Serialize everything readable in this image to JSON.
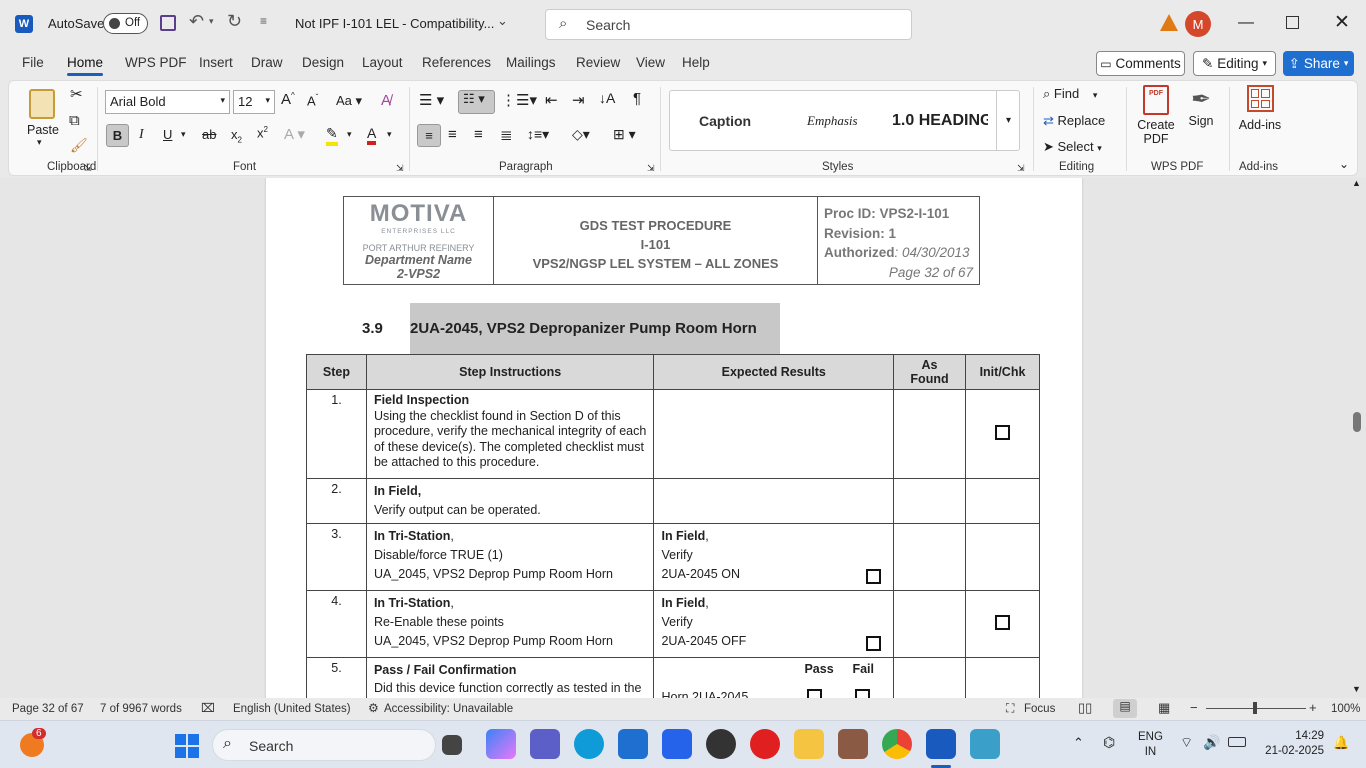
{
  "titlebar": {
    "autosave_label": "AutoSave",
    "autosave_state": "Off",
    "doc_title": "Not IPF I-101 LEL  -  Compatibility...",
    "search_placeholder": "Search",
    "user_initial": "M"
  },
  "tabs": [
    "File",
    "Home",
    "WPS PDF",
    "Insert",
    "Draw",
    "Design",
    "Layout",
    "References",
    "Mailings",
    "Review",
    "View",
    "Help"
  ],
  "tabs_right": {
    "comments": "Comments",
    "editing": "Editing",
    "share": "Share"
  },
  "ribbon": {
    "clipboard": {
      "paste": "Paste",
      "group": "Clipboard"
    },
    "font": {
      "name": "Arial Bold",
      "size": "12",
      "group": "Font",
      "bold": "B",
      "italic": "I",
      "underline": "U"
    },
    "paragraph": {
      "group": "Paragraph"
    },
    "styles": {
      "group": "Styles",
      "items": [
        "Caption",
        "Emphasis",
        "1.0  HEADING"
      ]
    },
    "editing": {
      "group": "Editing",
      "find": "Find",
      "replace": "Replace",
      "select": "Select"
    },
    "wpspdf": {
      "group": "WPS PDF",
      "create_pdf_line1": "Create",
      "create_pdf_line2": "PDF",
      "sign": "Sign"
    },
    "addins": {
      "group": "Add-ins",
      "label": "Add-ins"
    }
  },
  "doc": {
    "logo": {
      "name": "MOTIVA",
      "sub": "ENTERPRISES LLC",
      "refinery": "PORT ARTHUR REFINERY",
      "dept1": "Department Name",
      "dept2": "2-VPS2"
    },
    "header_center": {
      "l1": "GDS TEST PROCEDURE",
      "l2": "I-101",
      "l3": "VPS2/NGSP LEL SYSTEM – ALL ZONES"
    },
    "header_right": {
      "proc": "Proc ID: VPS2-I-101",
      "rev": "Revision: 1",
      "auth_label": "Authorized",
      "auth_date": ": 04/30/2013",
      "page": "Page 32 of 67"
    },
    "section_num": "3.9",
    "section_title": "2UA-2045, VPS2 Depropanizer Pump Room Horn",
    "table_headers": [
      "Step",
      "Step Instructions",
      "Expected Results",
      "As Found",
      "Init/Chk"
    ],
    "rows": [
      {
        "step": "1.",
        "title": "Field Inspection",
        "text": "Using the checklist found in Section D of this procedure, verify the mechanical integrity of each of these device(s). The completed checklist must be attached to this procedure."
      },
      {
        "step": "2.",
        "title": "In Field,",
        "text": "Verify output can be operated."
      },
      {
        "step": "3.",
        "title": "In Tri-Station",
        "title_suffix": ",",
        "l2": "Disable/force TRUE (1)",
        "l3": "UA_2045, VPS2 Deprop Pump Room Horn",
        "exp_title": "In Field",
        "exp_suffix": ",",
        "exp_l2": "Verify",
        "exp_l3": "2UA-2045 ON"
      },
      {
        "step": "4.",
        "title": "In Tri-Station",
        "title_suffix": ",",
        "l2": "Re-Enable these points",
        "l3": "UA_2045, VPS2 Deprop Pump Room Horn",
        "exp_title": "In Field",
        "exp_suffix": ",",
        "exp_l2": "Verify",
        "exp_l3": "2UA-2045 OFF"
      },
      {
        "step": "5.",
        "title": "Pass / Fail Confirmation",
        "text": "Did this device function correctly as tested in the previous steps?",
        "pass": "Pass",
        "fail": "Fail",
        "exp_l1": "Horn 2UA-2045"
      }
    ]
  },
  "status": {
    "page": "Page 32 of 67",
    "words": "7 of 9967 words",
    "lang": "English (United States)",
    "access": "Accessibility: Unavailable",
    "focus": "Focus",
    "zoom": "100%"
  },
  "taskbar": {
    "badge": "6",
    "search": "Search",
    "lang1": "ENG",
    "lang2": "IN",
    "time": "14:29",
    "date": "21-02-2025"
  },
  "colors": {
    "accent": "#1f5db8",
    "share": "#1f6fd1",
    "word": "#185abd"
  }
}
